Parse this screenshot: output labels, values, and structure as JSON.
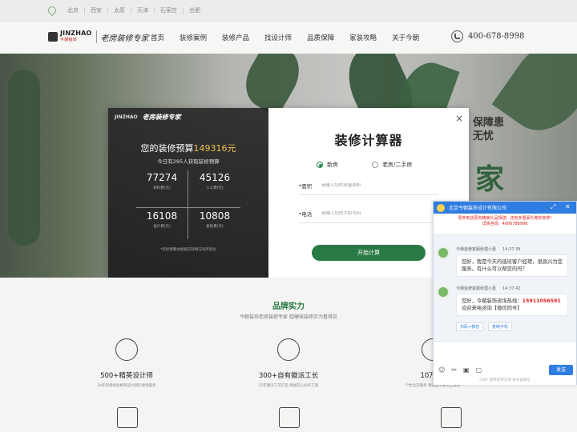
{
  "citybar": {
    "cities": [
      "北京",
      "西安",
      "太原",
      "天津",
      "石家庄",
      "合肥"
    ]
  },
  "header": {
    "logo_brand": "JINZHAO",
    "logo_brand_cn": "今朝装饰",
    "slogan": "老房装修专家",
    "nav": [
      "首页",
      "装修案例",
      "装修产品",
      "找设计师",
      "品质保障",
      "家装攻略",
      "关于今朝"
    ],
    "phone": "400-678-8998"
  },
  "hero": {
    "sign_line1": "保障患",
    "sign_line2": "无忧",
    "bigchar": "家"
  },
  "calculator": {
    "logo": "JINZHAO",
    "logo_slogan": "老房装修专家",
    "budget_prefix": "您的装修预算",
    "budget_amount": "149316元",
    "today_text": "今日有295人获取装修预算",
    "material_value": "77274",
    "material_label": "材料费(元)",
    "labor_value": "45126",
    "labor_label": "人工费(元)",
    "design_value": "16108",
    "design_label": "设计费(元)",
    "qc_value": "10808",
    "qc_label": "质检费(元)",
    "note": "*装修预算会根据实际情况有所变化",
    "title": "装修计算器",
    "option_new": "新房",
    "option_old": "老房/二手房",
    "area_label": "*面积",
    "area_placeholder": "请输入您的房屋面积",
    "phone_label": "*电话",
    "phone_placeholder": "请输入您的手机号码",
    "submit": "开始计算",
    "close": "×"
  },
  "brand": {
    "title": "品牌实力",
    "subtitle": "今朝装饰老房装修专家 超硬核装修实力看得见",
    "features": [
      {
        "title": "500+精英设计师",
        "desc": "24年装修经验精英设计团队倾情服务"
      },
      {
        "title": "300+自有徽派工长",
        "desc": "25年徽派工艺打造 明星匠心标杆工程"
      },
      {
        "title": "10万m²",
        "desc": "个性北京服务 德国施工服务全链条"
      }
    ]
  },
  "chat": {
    "header_title": "北京今朝装饰设计有限公司",
    "notice_line1": "周末到店更有精美礼品相送！还有多重豪礼等你来拿!",
    "notice_line2": "详情咨询：4006788998",
    "msg1_name": "今朝金牌客服经理小葛",
    "msg1_time": "14:37:39",
    "msg1_text": "您好，我是今天的值班客户经理，很高兴为您服务。有什么可以帮您的吗？",
    "msg2_name": "今朝金牌客服经理小葛",
    "msg2_time": "14:37:42",
    "msg2_prefix": "您好，今朝装饰咨询热线：",
    "msg2_hotline": "15911056591",
    "msg2_suffix": "欢迎来电咨询【微信同号】",
    "quick1": "扫码+微信",
    "quick2": "复制手机",
    "send": "发送",
    "powered": "53KF 提供软件支持  关于该账号"
  }
}
